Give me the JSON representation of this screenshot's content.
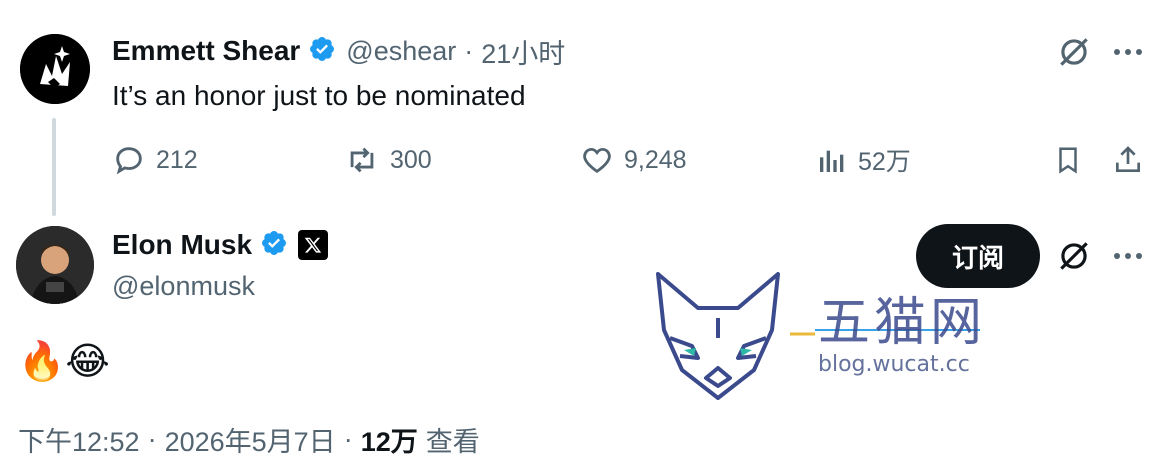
{
  "reply_to": {
    "author": "Emmett Shear",
    "handle": "@eshear",
    "separator": "·",
    "time": "21小时",
    "text": "It’s an honor just to be nominated",
    "stats": {
      "replies": "212",
      "reposts": "300",
      "likes": "9,248",
      "views": "52万"
    }
  },
  "tweet": {
    "author": "Elon Musk",
    "handle": "@elonmusk",
    "subscribe_label": "订阅",
    "emojis": "🔥😂",
    "footer": {
      "time": "下午12:52",
      "sep1": "·",
      "date": "2026年5月7日",
      "sep2": "·",
      "views_count": "12万",
      "views_label": "查看"
    }
  },
  "watermark": {
    "title": "五猫网",
    "url": "blog.wucat.cc"
  },
  "colors": {
    "text": "#0f1419",
    "muted": "#536471",
    "verified": "#1d9bf0",
    "thread_line": "#cfd9de",
    "button_dark": "#0f1419"
  },
  "icons": [
    "reply-icon",
    "repost-icon",
    "like-icon",
    "views-icon",
    "bookmark-icon",
    "share-icon",
    "grok-icon",
    "more-icon",
    "verified-badge-icon",
    "x-logo-icon"
  ]
}
